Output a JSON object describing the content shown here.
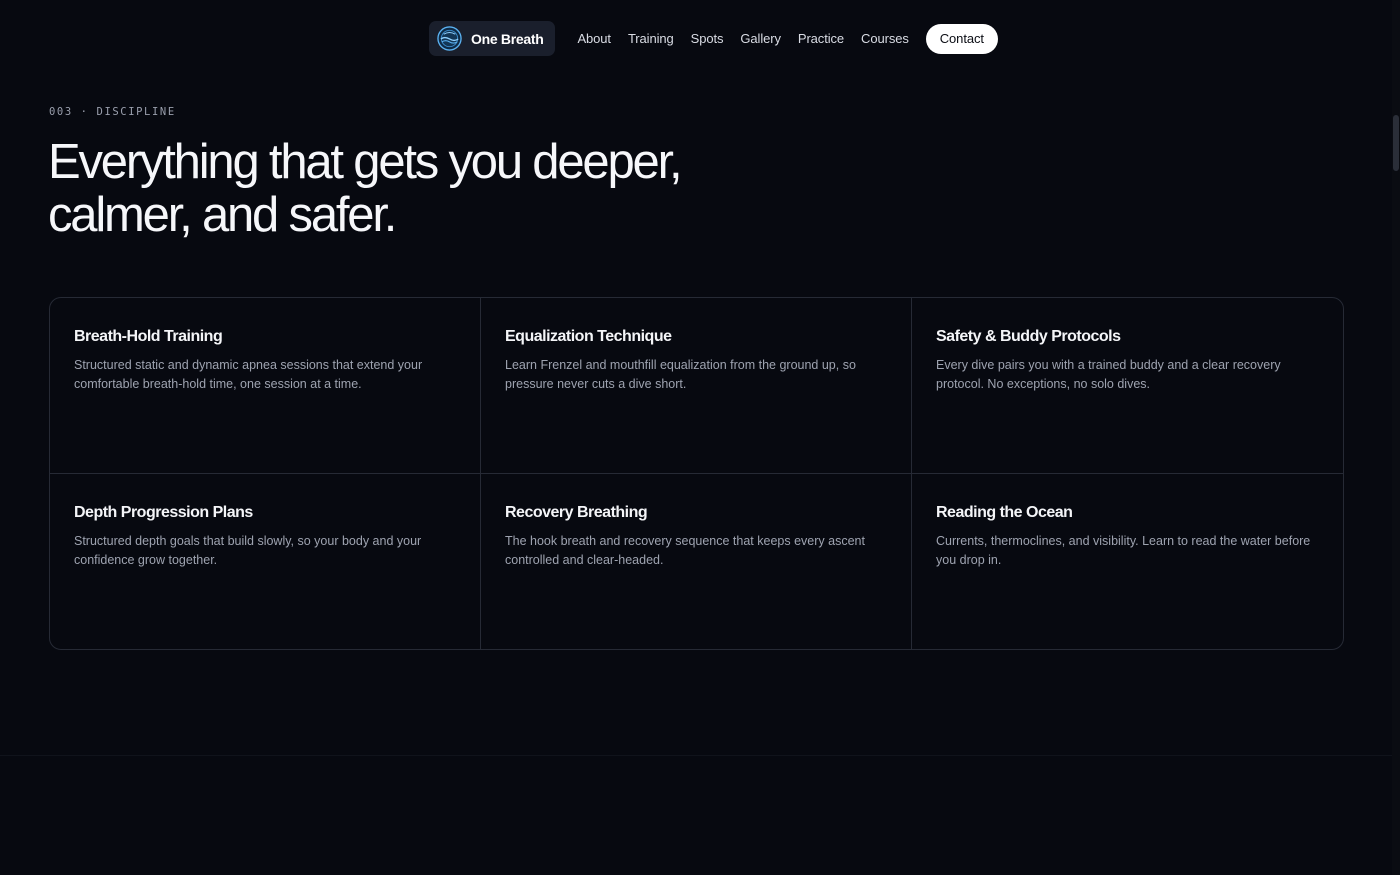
{
  "nav": {
    "brand": "One Breath",
    "links": [
      "About",
      "Training",
      "Spots",
      "Gallery",
      "Practice",
      "Courses"
    ],
    "cta": "Contact"
  },
  "section": {
    "eyebrow": "003 · DISCIPLINE",
    "headline_line1": "Everything that gets you deeper,",
    "headline_line2": "calmer, and safer."
  },
  "cards": [
    {
      "title": "Breath-Hold Training",
      "desc": "Structured static and dynamic apnea sessions that extend your comfortable breath-hold time, one session at a time."
    },
    {
      "title": "Equalization Technique",
      "desc": "Learn Frenzel and mouthfill equalization from the ground up, so pressure never cuts a dive short."
    },
    {
      "title": "Safety & Buddy Protocols",
      "desc": "Every dive pairs you with a trained buddy and a clear recovery protocol. No exceptions, no solo dives."
    },
    {
      "title": "Depth Progression Plans",
      "desc": "Structured depth goals that build slowly, so your body and your confidence grow together."
    },
    {
      "title": "Recovery Breathing",
      "desc": "The hook breath and recovery sequence that keeps every ascent controlled and clear-headed."
    },
    {
      "title": "Reading the Ocean",
      "desc": "Currents, thermoclines, and visibility. Learn to read the water before you drop in."
    }
  ],
  "colors": {
    "background": "#070910",
    "brand_pill": "#1a1f2c",
    "accent_blue": "#4aa3e8",
    "border": "#262a35"
  },
  "icons": {
    "brand_logo": "wave-circle-icon"
  }
}
